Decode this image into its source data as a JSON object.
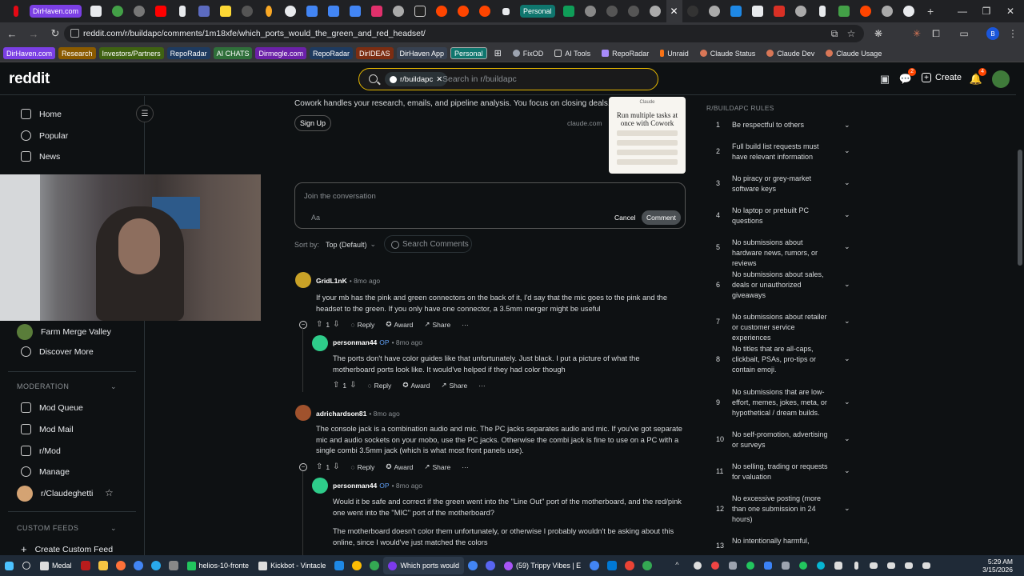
{
  "browser": {
    "tab_chips": [
      "DirHaven.com",
      "Personal"
    ],
    "url": "reddit.com/r/buildapc/comments/1m18xfe/which_ports_would_the_green_and_red_headset/"
  },
  "bookmarks": {
    "chips": [
      {
        "label": "DirHaven.com",
        "color": "#7b3fe4"
      },
      {
        "label": "Research",
        "color": "#8a5a00"
      },
      {
        "label": "Investors/Partners",
        "color": "#3f6212"
      },
      {
        "label": "RepoRadar",
        "color": "#1e3a5f"
      },
      {
        "label": "AI CHATS",
        "color": "#2f6f3a"
      },
      {
        "label": "Dirmegle.com",
        "color": "#6b21a8"
      },
      {
        "label": "RepoRadar",
        "color": "#1e3a5f"
      },
      {
        "label": "DirIDEAS",
        "color": "#7c2d12"
      },
      {
        "label": "DirHaven App",
        "color": "#374151"
      },
      {
        "label": "Personal",
        "color": "#0f766e"
      }
    ],
    "plain": [
      {
        "label": "FixOD",
        "color": "#9ca3af"
      },
      {
        "label": "AI Tools",
        "color": "#9ca3af"
      },
      {
        "label": "RepoRadar",
        "color": "#a78bfa"
      },
      {
        "label": "Unraid",
        "color": "#f97316"
      },
      {
        "label": "Claude Status",
        "color": "#d97757"
      },
      {
        "label": "Claude Dev",
        "color": "#d97757"
      },
      {
        "label": "Claude Usage",
        "color": "#d97757"
      }
    ]
  },
  "header": {
    "logo": "reddit",
    "subreddit_pill": "r/buildapc",
    "search_placeholder": "Search in r/buildapc",
    "create": "Create",
    "chat_badge": "2",
    "notif_badge": "4"
  },
  "sidebar": {
    "items": [
      "Home",
      "Popular",
      "News"
    ],
    "items_lower": [
      "Farm Merge Valley",
      "Discover More"
    ],
    "moderation_head": "MODERATION",
    "mod_items": [
      "Mod Queue",
      "Mod Mail",
      "r/Mod",
      "Manage",
      "r/Claudeghetti"
    ],
    "custom_head": "CUSTOM FEEDS",
    "create_feed": "Create Custom Feed"
  },
  "ad": {
    "text": "Cowork handles your research, emails, and pipeline analysis. You focus on closing deals.",
    "signup": "Sign Up",
    "source": "claude.com",
    "image_brand": "Claude",
    "image_headline": "Run multiple tasks at once with Cowork"
  },
  "composer": {
    "placeholder": "Join the conversation",
    "aa": "Aa",
    "cancel": "Cancel",
    "comment": "Comment"
  },
  "sort": {
    "label": "Sort by:",
    "value": "Top (Default)",
    "search": "Search Comments"
  },
  "comments": [
    {
      "user": "GridL1nK",
      "op": "",
      "meta": "• 8mo ago",
      "body": "If your mb has the pink and green connectors on the back of it, I'd say that the mic goes to the pink and the headset to the green. If you only have one connector, a 3.5mm merger might be useful",
      "votes": "1"
    },
    {
      "user": "personman44",
      "op": "OP",
      "meta": "• 8mo ago",
      "body": "The ports don't have color guides like that unfortunately. Just black. I put a picture of what the motherboard ports look like. It would've helped if they had color though",
      "votes": "1"
    },
    {
      "user": "adrichardson81",
      "op": "",
      "meta": "• 8mo ago",
      "body": "The console jack is a combination audio and mic. The PC jacks separates audio and mic. If you've got separate mic and audio sockets on your mobo, use the PC jacks. Otherwise the combi jack is fine to use on a PC with a single combi 3.5mm jack (which is what most front panels use).",
      "votes": "1"
    },
    {
      "user": "personman44",
      "op": "OP",
      "meta": "• 8mo ago",
      "body": "Would it be safe and correct if the green went into the \"Line Out\" port of the motherboard, and the red/pink one went into the \"MIC\" port of the motherboard?",
      "body2": "The motherboard doesn't color them unfortunately, or otherwise I probably wouldn't be asking about this online, since I would've just matched the colors",
      "votes": ""
    }
  ],
  "actions": {
    "reply": "Reply",
    "award": "Award",
    "share": "Share",
    "more": "···"
  },
  "rules": {
    "title": "R/BUILDAPC RULES",
    "items": [
      {
        "n": "1",
        "t": "Be respectful to others"
      },
      {
        "n": "2",
        "t": "Full build list requests must have relevant information"
      },
      {
        "n": "3",
        "t": "No piracy or grey-market software keys"
      },
      {
        "n": "4",
        "t": "No laptop or prebuilt PC questions"
      },
      {
        "n": "5",
        "t": "No submissions about hardware news, rumors, or reviews"
      },
      {
        "n": "6",
        "t": "No submissions about sales, deals or unauthorized giveaways"
      },
      {
        "n": "7",
        "t": "No submissions about retailer or customer service experiences"
      },
      {
        "n": "8",
        "t": "No titles that are all-caps, clickbait, PSAs, pro-tips or contain emoji."
      },
      {
        "n": "9",
        "t": "No submissions that are low-effort, memes, jokes, meta, or hypothetical / dream builds."
      },
      {
        "n": "10",
        "t": "No self-promotion, advertising or surveys"
      },
      {
        "n": "11",
        "t": "No selling, trading or requests for valuation"
      },
      {
        "n": "12",
        "t": "No excessive posting (more than one submission in 24 hours)"
      },
      {
        "n": "13",
        "t": "No intentionally harmful,"
      }
    ]
  },
  "taskbar": {
    "apps": [
      "Medal",
      "helios-10-fronte",
      "Kickbot - Vintacle",
      "Which ports would",
      "(59) Trippy Vibes | E"
    ],
    "time": "5:29 AM",
    "date": "3/15/2026"
  }
}
